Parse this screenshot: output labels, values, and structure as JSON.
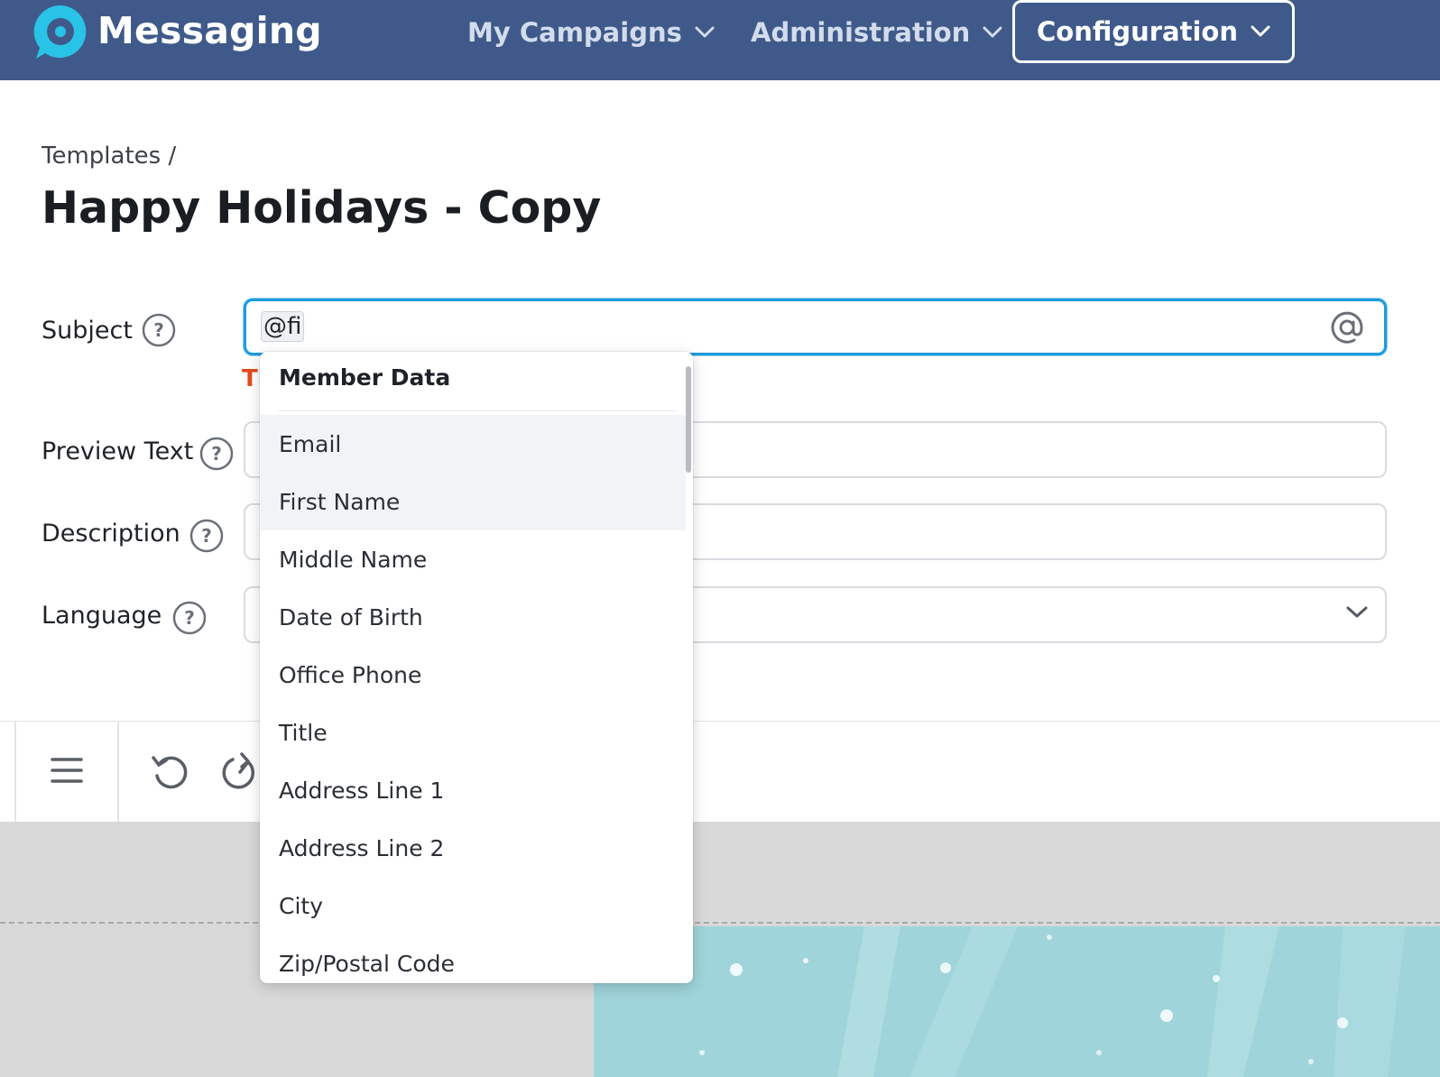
{
  "app": {
    "title": "Messaging"
  },
  "nav": {
    "my_campaigns": "My Campaigns",
    "administration": "Administration",
    "configuration": "Configuration"
  },
  "header": {
    "breadcrumb": "Templates /",
    "title": "Happy Holidays - Copy"
  },
  "form": {
    "subject": {
      "label": "Subject",
      "value": "@fi"
    },
    "error_text": "Tl",
    "preview_text": {
      "label": "Preview Text",
      "value": ""
    },
    "description": {
      "label": "Description",
      "value": ""
    },
    "language": {
      "label": "Language",
      "value": ""
    }
  },
  "dropdown": {
    "header": "Member Data",
    "items": [
      "Email",
      "First Name",
      "Middle Name",
      "Date of Birth",
      "Office Phone",
      "Title",
      "Address Line 1",
      "Address Line 2",
      "City",
      "Zip/Postal Code"
    ]
  },
  "colors": {
    "nav_bg": "#3f5a8a",
    "accent": "#1e9bdb",
    "logo": "#29c3e8",
    "error": "#e34b1f",
    "hero_bg": "#9fd4da"
  },
  "icons": [
    "chat-bubble-logo",
    "chevron-down-icon",
    "help-icon",
    "at-sign-icon",
    "hamburger-menu-icon",
    "undo-icon",
    "redo-icon"
  ]
}
